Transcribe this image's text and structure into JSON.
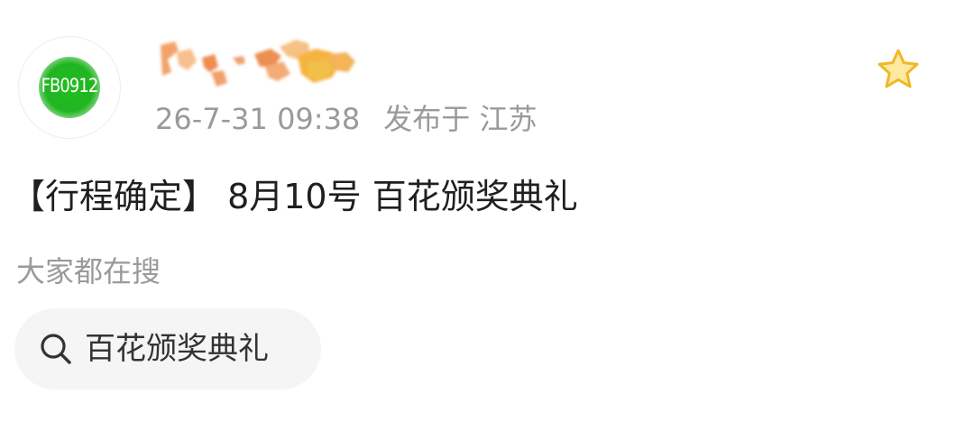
{
  "post": {
    "avatar_text": "FB0912",
    "timestamp": "26-7-31 09:38",
    "location_prefix": "发布于",
    "location": "江苏",
    "title": "【行程确定】 8月10号 百花颁奖典礼"
  },
  "trending": {
    "label": "大家都在搜",
    "chips": [
      {
        "label": "百花颁奖典礼"
      }
    ]
  },
  "colors": {
    "avatar_green": "#21b521",
    "meta_gray": "#9a9a9a",
    "star_fill": "#fde9a0",
    "star_stroke": "#f0b828",
    "chip_background": "#f5f5f5"
  },
  "icons": {
    "favorite": "star-icon",
    "search": "search-icon"
  }
}
